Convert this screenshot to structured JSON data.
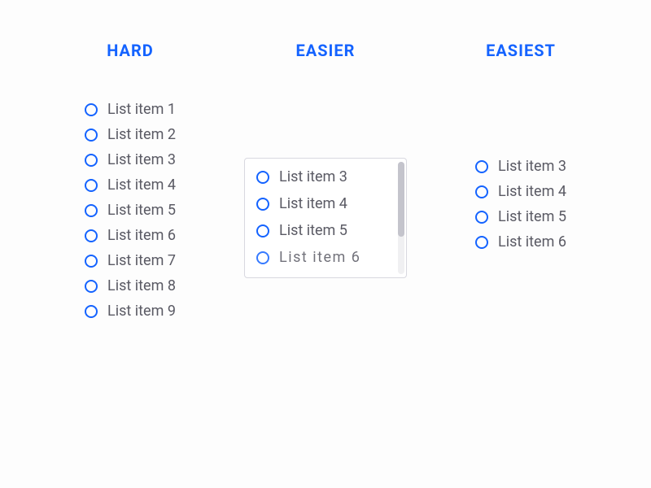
{
  "columns": {
    "hard": {
      "heading": "HARD",
      "items": [
        "List item 1",
        "List item 2",
        "List item 3",
        "List item 4",
        "List item 5",
        "List item 6",
        "List item 7",
        "List item 8",
        "List item 9"
      ]
    },
    "easier": {
      "heading": "EASIER",
      "items": [
        "List item 3",
        "List item 4",
        "List item 5",
        "List item 6"
      ]
    },
    "easiest": {
      "heading": "EASIEST",
      "items": [
        "List item 3",
        "List item 4",
        "List item 5",
        "List item 6"
      ]
    }
  }
}
